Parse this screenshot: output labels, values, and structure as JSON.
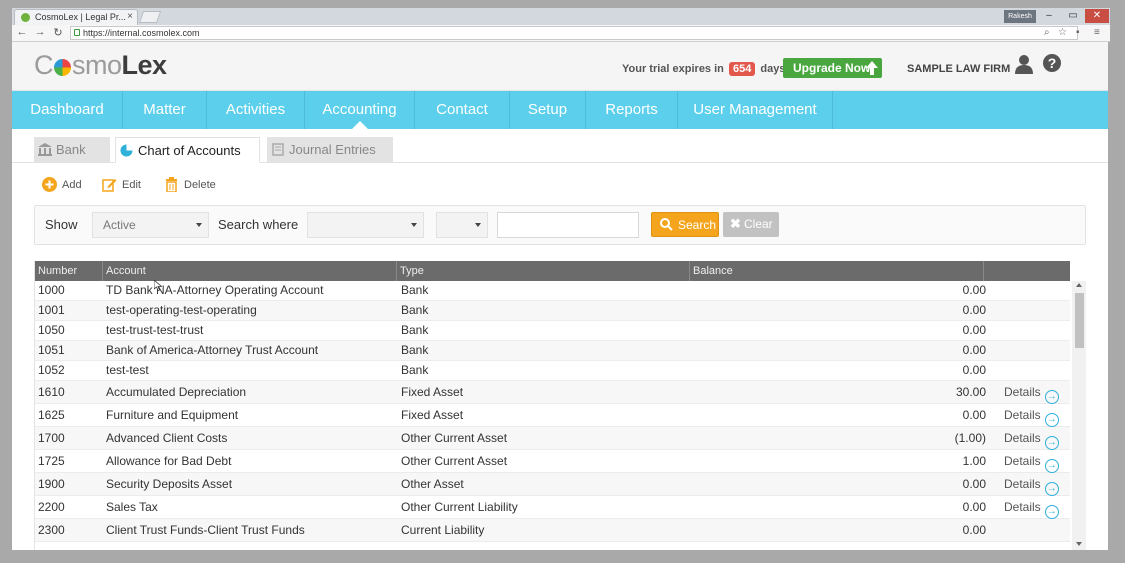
{
  "browser": {
    "tab_title": "CosmoLex | Legal Pr...",
    "url": "https://internal.cosmolex.com",
    "profile_name": "Rakesh"
  },
  "header": {
    "logo": {
      "part1": "C",
      "part2": "smo",
      "part3": "Lex"
    },
    "trial_prefix": "Your trial expires in",
    "trial_days": "654",
    "trial_suffix": "days.",
    "upgrade_label": "Upgrade Now",
    "firm_name": "SAMPLE LAW FIRM"
  },
  "nav": {
    "items": [
      "Dashboard",
      "Matter",
      "Activities",
      "Accounting",
      "Contact",
      "Setup",
      "Reports",
      "User Management"
    ],
    "active": "Accounting"
  },
  "subtabs": [
    "Bank",
    "Chart of Accounts",
    "Journal Entries"
  ],
  "actions": {
    "add": "Add",
    "edit": "Edit",
    "delete": "Delete"
  },
  "filter": {
    "show_label": "Show",
    "show_value": "Active",
    "search_where_label": "Search where",
    "search_where_value": "",
    "operator_value": "",
    "search_text": "",
    "search_button": "Search",
    "clear_button": "Clear"
  },
  "table": {
    "headers": [
      "Number",
      "Account",
      "Type",
      "Balance",
      ""
    ],
    "rows": [
      {
        "number": "1000",
        "account": "TD Bank NA-Attorney Operating Account",
        "type": "Bank",
        "balance": "0.00",
        "details": ""
      },
      {
        "number": "1001",
        "account": "test-operating-test-operating",
        "type": "Bank",
        "balance": "0.00",
        "details": ""
      },
      {
        "number": "1050",
        "account": "test-trust-test-trust",
        "type": "Bank",
        "balance": "0.00",
        "details": ""
      },
      {
        "number": "1051",
        "account": "Bank of America-Attorney Trust Account",
        "type": "Bank",
        "balance": "0.00",
        "details": ""
      },
      {
        "number": "1052",
        "account": "test-test",
        "type": "Bank",
        "balance": "0.00",
        "details": ""
      },
      {
        "number": "1610",
        "account": "Accumulated Depreciation",
        "type": "Fixed Asset",
        "balance": "30.00",
        "details": "Details"
      },
      {
        "number": "1625",
        "account": "Furniture and Equipment",
        "type": "Fixed Asset",
        "balance": "0.00",
        "details": "Details"
      },
      {
        "number": "1700",
        "account": "Advanced Client Costs",
        "type": "Other Current Asset",
        "balance": "(1.00)",
        "details": "Details"
      },
      {
        "number": "1725",
        "account": "Allowance for Bad Debt",
        "type": "Other Current Asset",
        "balance": "1.00",
        "details": "Details"
      },
      {
        "number": "1900",
        "account": "Security Deposits Asset",
        "type": "Other Asset",
        "balance": "0.00",
        "details": "Details"
      },
      {
        "number": "2200",
        "account": "Sales Tax",
        "type": "Other Current Liability",
        "balance": "0.00",
        "details": "Details"
      },
      {
        "number": "2300",
        "account": "Client Trust Funds-Client Trust Funds",
        "type": "Current Liability",
        "balance": "0.00",
        "details": ""
      }
    ]
  }
}
